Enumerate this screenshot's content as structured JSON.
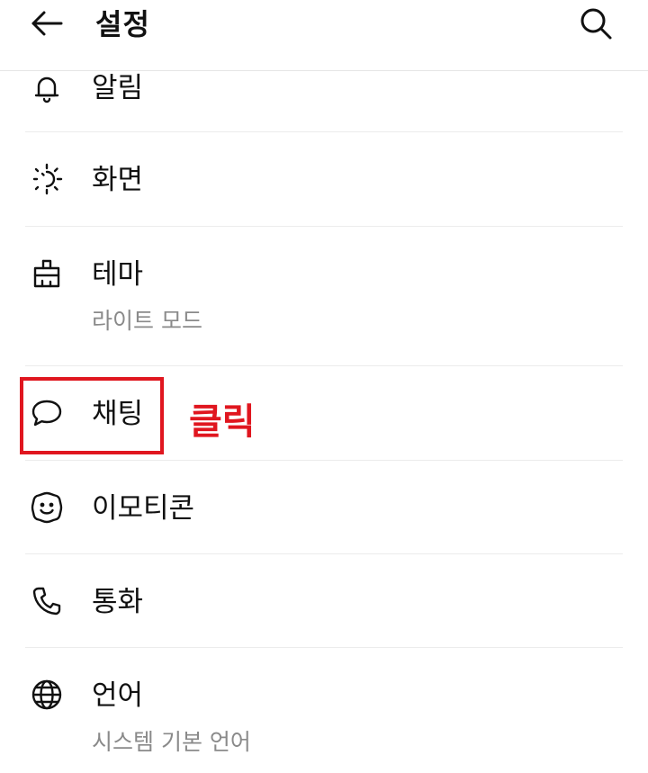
{
  "header": {
    "title": "설정",
    "back_icon": "arrow-left-icon",
    "search_icon": "search-icon"
  },
  "items": [
    {
      "label": "알림",
      "icon": "bell-icon",
      "sublabel": ""
    },
    {
      "label": "화면",
      "icon": "brightness-icon",
      "sublabel": ""
    },
    {
      "label": "테마",
      "icon": "paint-brush-icon",
      "sublabel": "라이트 모드"
    },
    {
      "label": "채팅",
      "icon": "chat-bubble-icon",
      "sublabel": ""
    },
    {
      "label": "이모티콘",
      "icon": "smiley-icon",
      "sublabel": ""
    },
    {
      "label": "통화",
      "icon": "phone-icon",
      "sublabel": ""
    },
    {
      "label": "언어",
      "icon": "globe-icon",
      "sublabel": "시스템 기본 언어"
    }
  ],
  "annotation": {
    "text": "클릭",
    "color": "#e0161f"
  }
}
